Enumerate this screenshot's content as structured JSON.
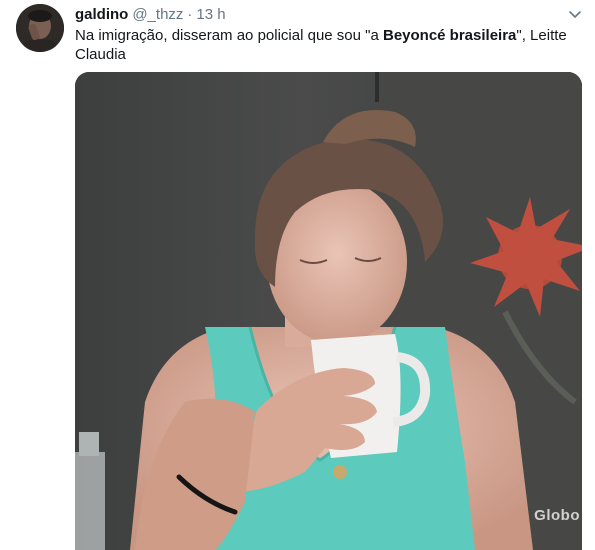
{
  "tweet": {
    "author_name": "galdino",
    "author_handle": "@_thzz",
    "separator": "·",
    "timestamp": "13 h",
    "text_part1": "Na imigração, disseram ao policial que sou \"a ",
    "text_bold": "Beyoncé brasileira",
    "text_part2": "\", Leitte Claudia",
    "caret_icon": "chevron-down-icon"
  },
  "media": {
    "watermark": "Globo",
    "accent_colors": {
      "top_color": "#5ed3c7",
      "background": "#3e4040"
    }
  }
}
